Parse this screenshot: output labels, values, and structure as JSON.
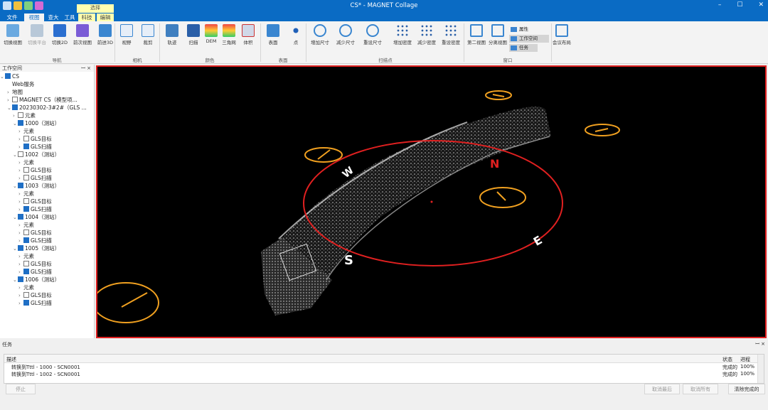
{
  "window": {
    "title": "CS* - MAGNET Collage",
    "context_group": "选择",
    "controls": [
      "–",
      "☐",
      "✕"
    ]
  },
  "tabs": [
    {
      "label": "文件"
    },
    {
      "label": "视图"
    },
    {
      "label": "查大"
    },
    {
      "label": "工具"
    },
    {
      "label": "科技"
    },
    {
      "label": "编辑"
    }
  ],
  "ribbon": {
    "groups": {
      "nav": "导航",
      "camera": "相机",
      "color": "颜色",
      "surface": "表面",
      "scanpt": "扫描点",
      "window": "窗口"
    },
    "buttons": {
      "b1": "切换视图",
      "b2": "切换平台",
      "b3": "切换2D",
      "b4": "前次视图",
      "b5": "前进3D",
      "b6": "视野",
      "b7": "裁剪",
      "b8": "轨迹",
      "b9": "扫描",
      "b10": "DEM",
      "b11": "三角网",
      "b12": "体积",
      "b13": "表面",
      "b14": "点",
      "b15": "增加尺寸",
      "b16": "减少尺寸",
      "b17": "重设尺寸",
      "b18": "增加密度",
      "b19": "减少密度",
      "b20": "重设密度",
      "b21": "第二视图",
      "b22": "分离视图",
      "b23": "会议布局"
    },
    "window_items": [
      "属性",
      "工作空间",
      "任务"
    ]
  },
  "workspace": {
    "title": "工作空间",
    "tree": [
      {
        "label": "CS",
        "arrow": "v",
        "check": "on"
      },
      {
        "label": "Web服务",
        "arrow": "",
        "check": ""
      },
      {
        "label": "地图",
        "arrow": ">",
        "check": ""
      },
      {
        "label": "MAGNET CS（模型项...",
        "arrow": ">",
        "check": "off"
      },
      {
        "label": "20230302-3#2#（GLS ...",
        "arrow": "v",
        "check": "on"
      },
      {
        "label": "元素",
        "arrow": ">",
        "check": "off"
      },
      {
        "label": "1000（测站）",
        "arrow": "v",
        "check": "on"
      },
      {
        "label": "元素",
        "arrow": ">",
        "check": ""
      },
      {
        "label": "GLS目标",
        "arrow": ">",
        "check": "off"
      },
      {
        "label": "GLS扫描",
        "arrow": ">",
        "check": "on"
      },
      {
        "label": "1002（测站）",
        "arrow": "v",
        "check": "off"
      },
      {
        "label": "元素",
        "arrow": ">",
        "check": ""
      },
      {
        "label": "GLS目标",
        "arrow": ">",
        "check": "off"
      },
      {
        "label": "GLS扫描",
        "arrow": ">",
        "check": "off"
      },
      {
        "label": "1003（测站）",
        "arrow": "v",
        "check": "on"
      },
      {
        "label": "元素",
        "arrow": ">",
        "check": ""
      },
      {
        "label": "GLS目标",
        "arrow": ">",
        "check": "off"
      },
      {
        "label": "GLS扫描",
        "arrow": ">",
        "check": "on"
      },
      {
        "label": "1004（测站）",
        "arrow": "v",
        "check": "on"
      },
      {
        "label": "元素",
        "arrow": ">",
        "check": ""
      },
      {
        "label": "GLS目标",
        "arrow": ">",
        "check": "off"
      },
      {
        "label": "GLS扫描",
        "arrow": ">",
        "check": "on"
      },
      {
        "label": "1005（测站）",
        "arrow": "v",
        "check": "on"
      },
      {
        "label": "元素",
        "arrow": ">",
        "check": ""
      },
      {
        "label": "GLS目标",
        "arrow": ">",
        "check": "off"
      },
      {
        "label": "GLS扫描",
        "arrow": ">",
        "check": "on"
      },
      {
        "label": "1006（测站）",
        "arrow": "v",
        "check": "on"
      },
      {
        "label": "元素",
        "arrow": ">",
        "check": ""
      },
      {
        "label": "GLS目标",
        "arrow": ">",
        "check": "off"
      },
      {
        "label": "GLS扫描",
        "arrow": ">",
        "check": "on"
      }
    ]
  },
  "viewport": {
    "compass": {
      "n": "N",
      "s": "S",
      "e": "E",
      "w": "W"
    }
  },
  "tasks": {
    "title": "任务",
    "columns": {
      "desc": "描述",
      "status": "状态",
      "progress": "进程"
    },
    "rows": [
      {
        "desc": "转换到Tttl - 1000 - SCN0001",
        "status": "完成的",
        "progress": "100%"
      },
      {
        "desc": "转换到Tttl - 1002 - SCN0001",
        "status": "完成的",
        "progress": "100%"
      }
    ],
    "buttons": {
      "stop": "停止",
      "cancel_last": "取消最后",
      "cancel_all": "取消所有",
      "clear": "清除完成的"
    }
  },
  "colors": {
    "accent": "#0a6bc4",
    "selection_border": "#e02020",
    "marker": "#f0a020"
  }
}
